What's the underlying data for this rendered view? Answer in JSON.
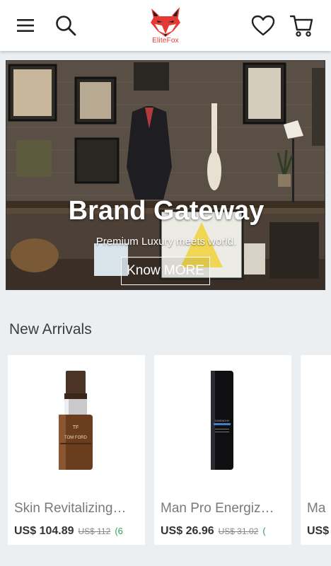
{
  "header": {
    "menu_icon": "hamburger-menu-icon",
    "search_icon": "search-icon",
    "brand_name": "EliteFox",
    "wishlist_icon": "heart-icon",
    "cart_icon": "cart-icon"
  },
  "hero": {
    "title": "Brand Gateway",
    "subtitle": "Premium Luxury meets world.",
    "button_label": "Know MORE"
  },
  "new_arrivals": {
    "title": "New Arrivals",
    "products": [
      {
        "name": "Skin Revitalizing…",
        "price": "US$ 104.89",
        "old_price": "US$ 112",
        "discount": "(6"
      },
      {
        "name": "Man Pro Energiz…",
        "price": "US$ 26.96",
        "old_price": "US$ 31.02",
        "discount": "("
      },
      {
        "name": "Ma",
        "price": "US$"
      }
    ]
  },
  "colors": {
    "brand_red": "#e53935",
    "discount_green": "#2e9e5b",
    "background": "#eceff1"
  }
}
